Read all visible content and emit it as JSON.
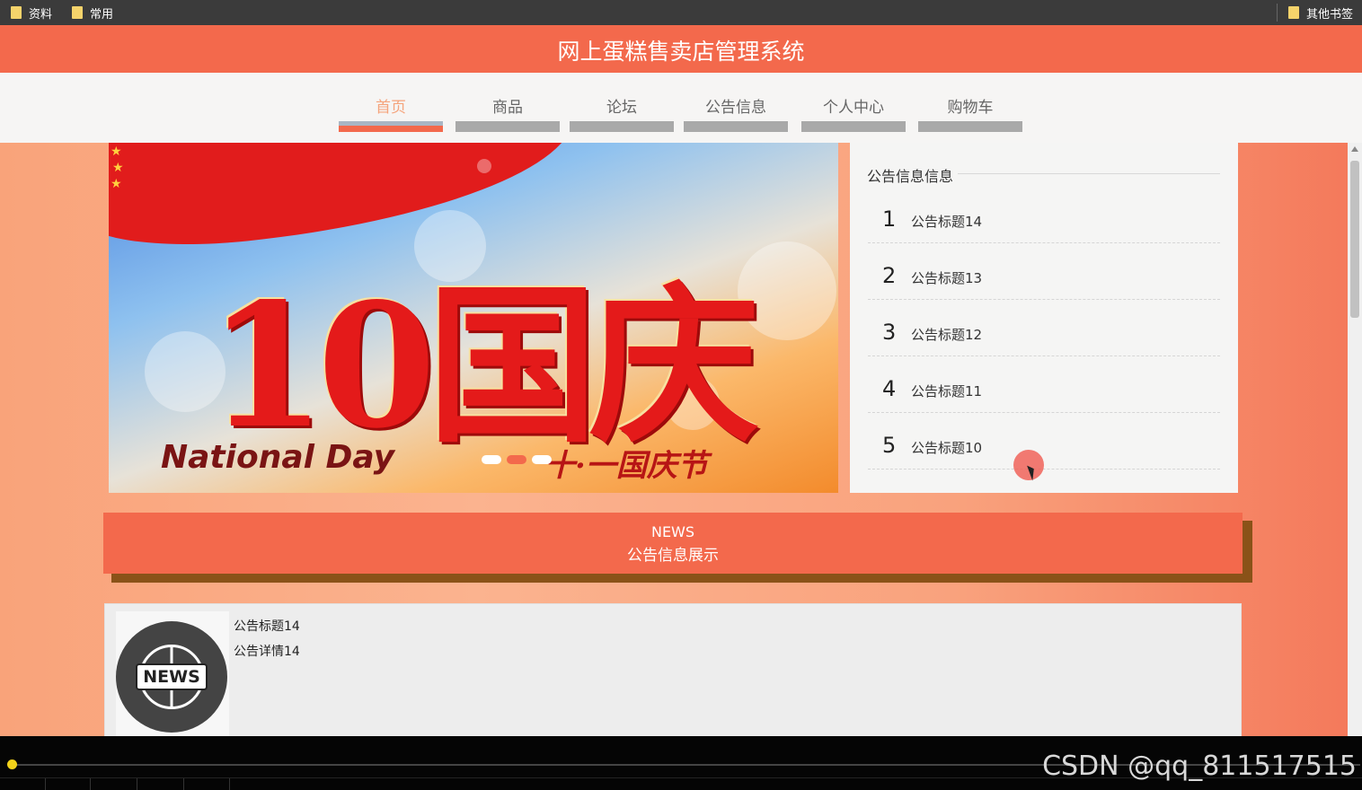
{
  "bookmarks": {
    "items": [
      {
        "label": "资料"
      },
      {
        "label": "常用"
      }
    ],
    "other": "其他书签"
  },
  "site": {
    "title": "网上蛋糕售卖店管理系统"
  },
  "nav": {
    "active_index": 0,
    "items": [
      {
        "label": "首页"
      },
      {
        "label": "商品"
      },
      {
        "label": "论坛"
      },
      {
        "label": "公告信息"
      },
      {
        "label": "个人中心"
      },
      {
        "label": "购物车"
      }
    ]
  },
  "banner": {
    "big_text": "10国庆",
    "english": "National Day",
    "chinese": "十·一国庆节",
    "slide_count": 3,
    "active_slide": 1
  },
  "notice_panel": {
    "title": "公告信息信息",
    "items": [
      {
        "num": "1",
        "title": "公告标题14"
      },
      {
        "num": "2",
        "title": "公告标题13"
      },
      {
        "num": "3",
        "title": "公告标题12"
      },
      {
        "num": "4",
        "title": "公告标题11"
      },
      {
        "num": "5",
        "title": "公告标题10"
      }
    ]
  },
  "news_section": {
    "en": "NEWS",
    "cn": "公告信息展示",
    "card": {
      "icon_label": "NEWS",
      "title": "公告标题14",
      "detail": "公告详情14"
    }
  },
  "player": {
    "watermark": "CSDN @qq_811517515"
  },
  "colors": {
    "accent": "#f3694c",
    "nav_active_text": "#f5a47c",
    "bookmark_bar": "#3b3b3b"
  }
}
